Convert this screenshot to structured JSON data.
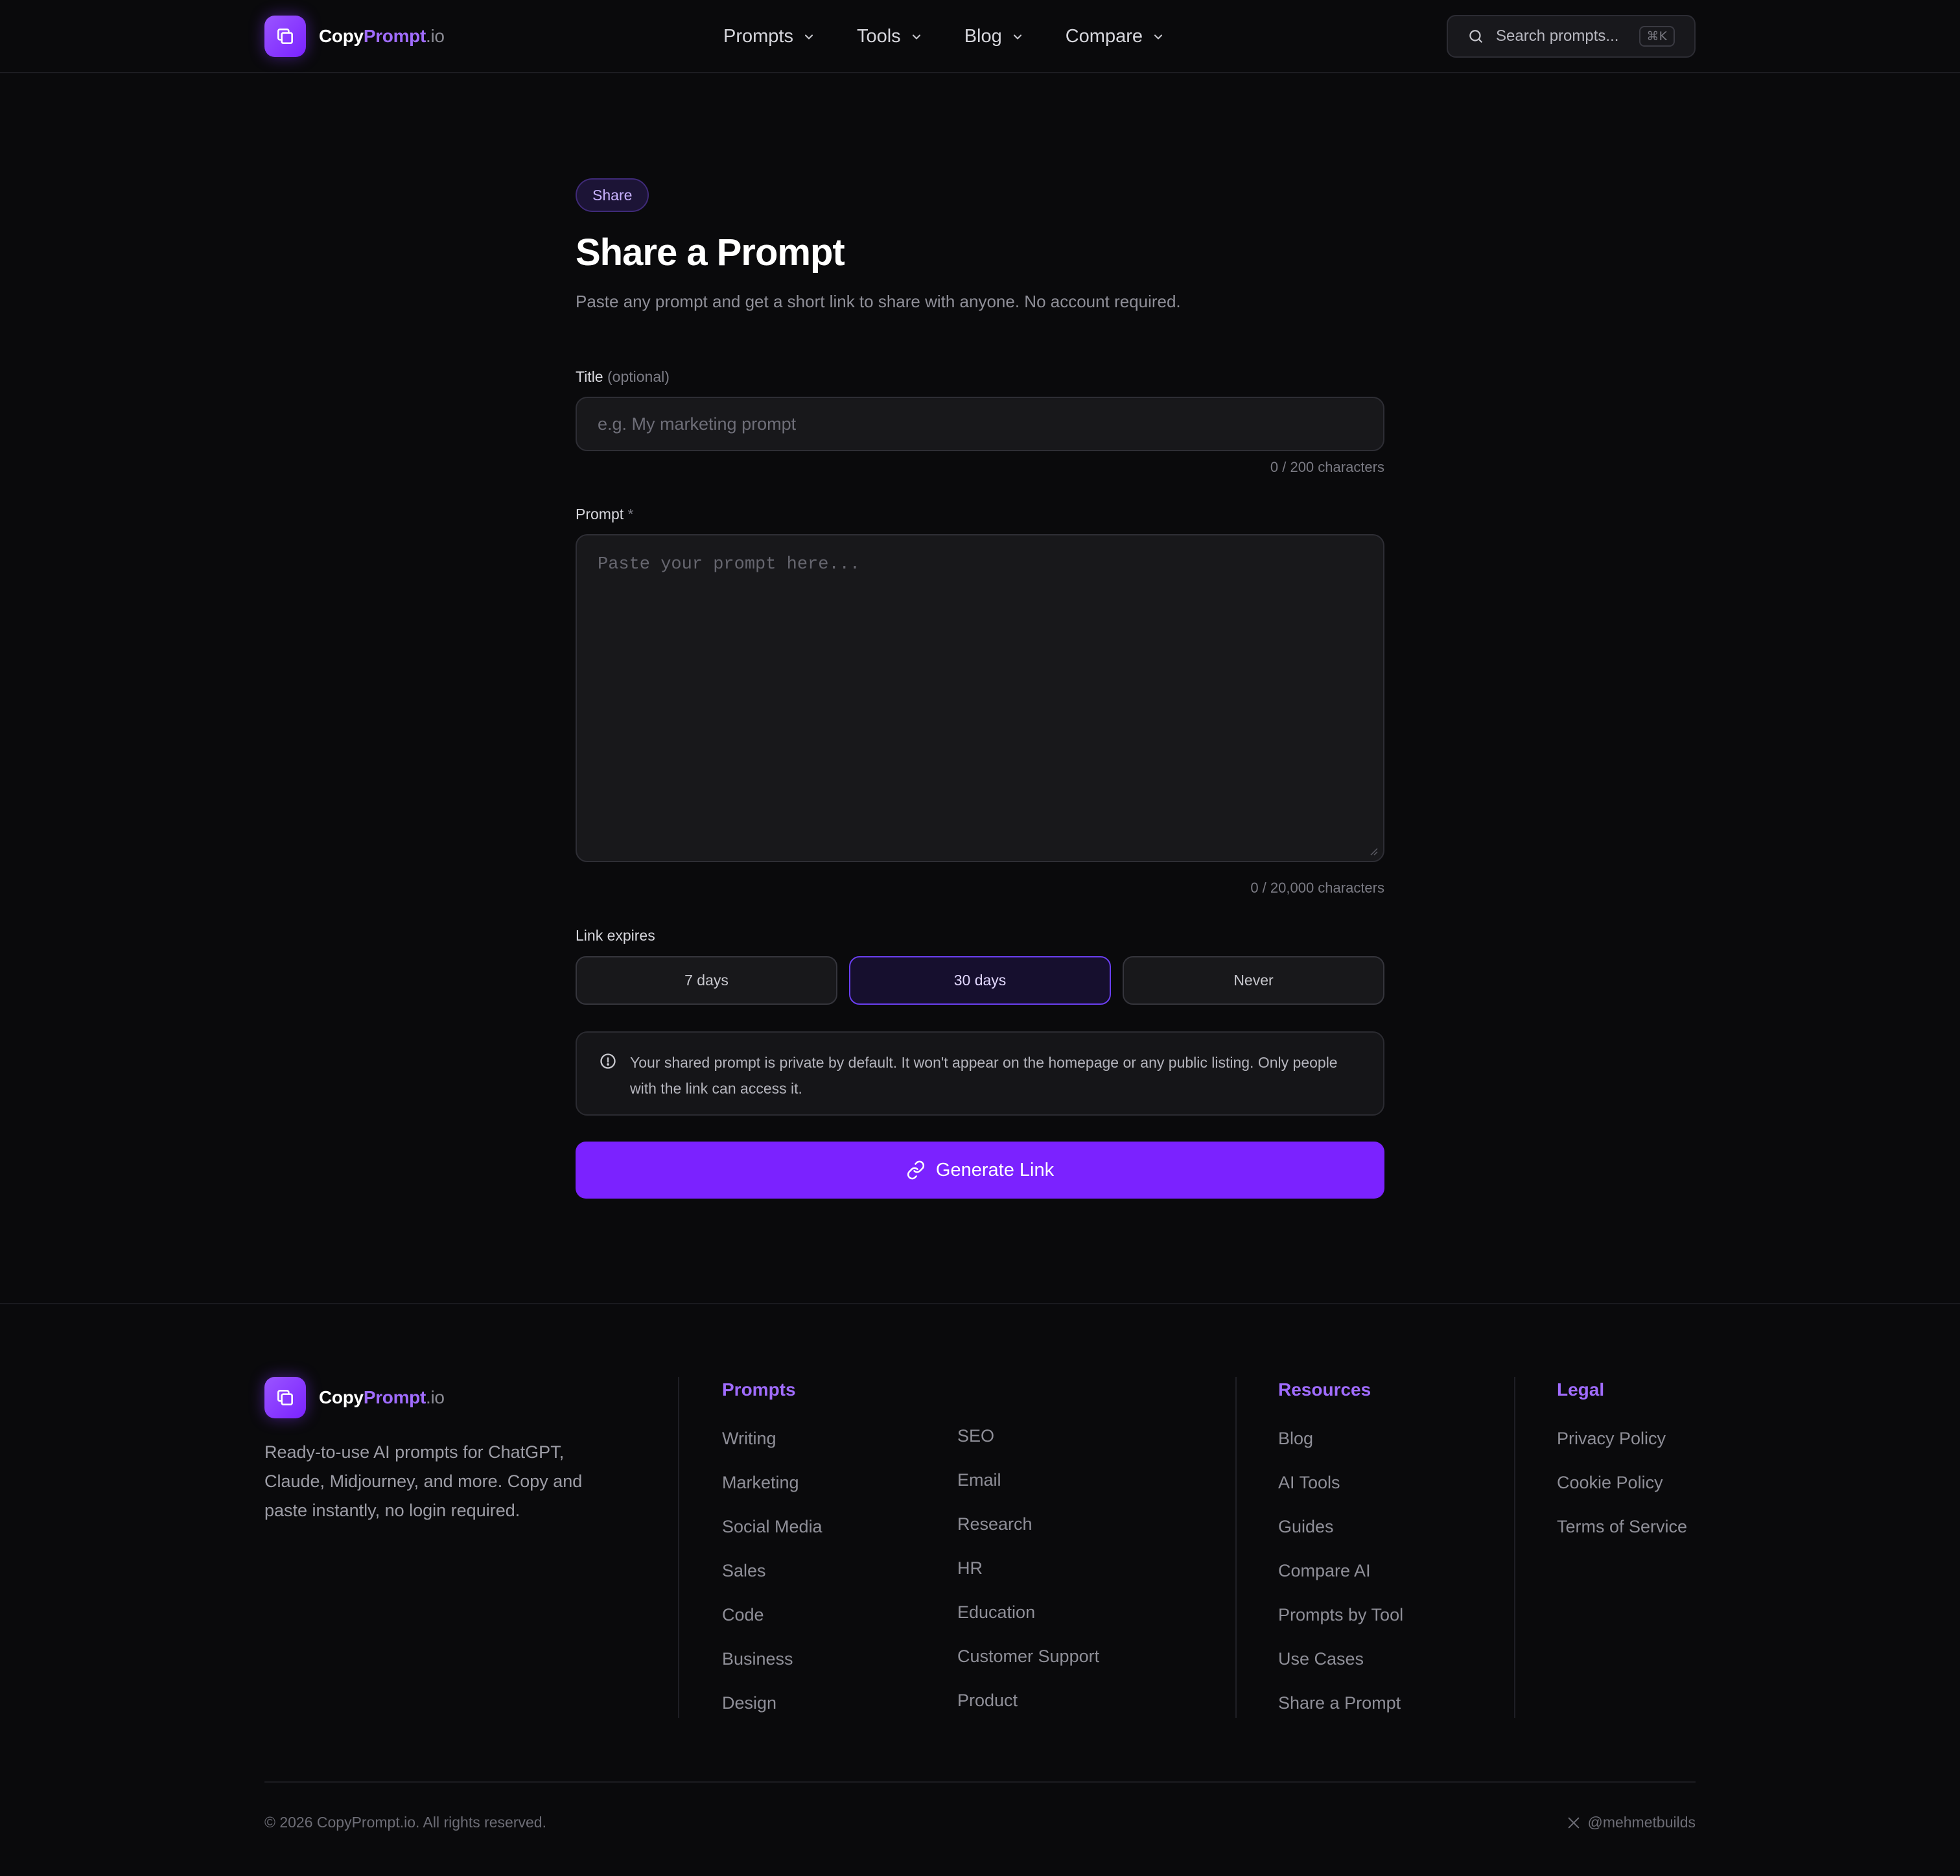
{
  "brand": {
    "name_primary": "Copy",
    "name_accent": "Prompt",
    "name_suffix": ".io",
    "accent_color": "#a06cff",
    "button_color": "#7b22ff"
  },
  "nav": {
    "items": [
      {
        "label": "Prompts",
        "icon": "chevron-down-icon"
      },
      {
        "label": "Tools",
        "icon": "chevron-down-icon"
      },
      {
        "label": "Blog",
        "icon": "chevron-down-icon"
      },
      {
        "label": "Compare",
        "icon": "chevron-down-icon"
      }
    ]
  },
  "search": {
    "placeholder": "Search prompts...",
    "shortcut": "⌘K",
    "icon": "search-icon"
  },
  "main": {
    "badge": "Share",
    "title": "Share a Prompt",
    "subtitle": "Paste any prompt and get a short link to share with anyone. No account required.",
    "title_field": {
      "label": "Title",
      "label_hint": "(optional)",
      "placeholder": "e.g. My marketing prompt",
      "value": "",
      "counter": "0 / 200 characters"
    },
    "prompt_field": {
      "label": "Prompt",
      "required_mark": "*",
      "placeholder": "Paste your prompt here...",
      "value": "",
      "counter": "0 / 20,000 characters"
    },
    "expiry": {
      "label": "Link expires",
      "options": [
        "7 days",
        "30 days",
        "Never"
      ],
      "selected": "30 days"
    },
    "notice": {
      "icon": "info-icon",
      "text": "Your shared prompt is private by default. It won't appear on the homepage or any public listing. Only people with the link can access it."
    },
    "generate_button": {
      "label": "Generate Link",
      "icon": "link-icon"
    }
  },
  "footer": {
    "description": "Ready-to-use AI prompts for ChatGPT, Claude, Midjourney, and more. Copy and paste instantly, no login required.",
    "columns": {
      "prompts": {
        "title": "Prompts",
        "left": [
          "Writing",
          "Marketing",
          "Social Media",
          "Sales",
          "Code",
          "Business",
          "Design"
        ],
        "right": [
          "SEO",
          "Email",
          "Research",
          "HR",
          "Education",
          "Customer Support",
          "Product"
        ]
      },
      "resources": {
        "title": "Resources",
        "links": [
          "Blog",
          "AI Tools",
          "Guides",
          "Compare AI",
          "Prompts by Tool",
          "Use Cases",
          "Share a Prompt"
        ]
      },
      "legal": {
        "title": "Legal",
        "links": [
          "Privacy Policy",
          "Cookie Policy",
          "Terms of Service"
        ]
      }
    },
    "copyright": "© 2026 CopyPrompt.io. All rights reserved.",
    "social": {
      "icon": "x-icon",
      "handle": "@mehmetbuilds"
    }
  }
}
